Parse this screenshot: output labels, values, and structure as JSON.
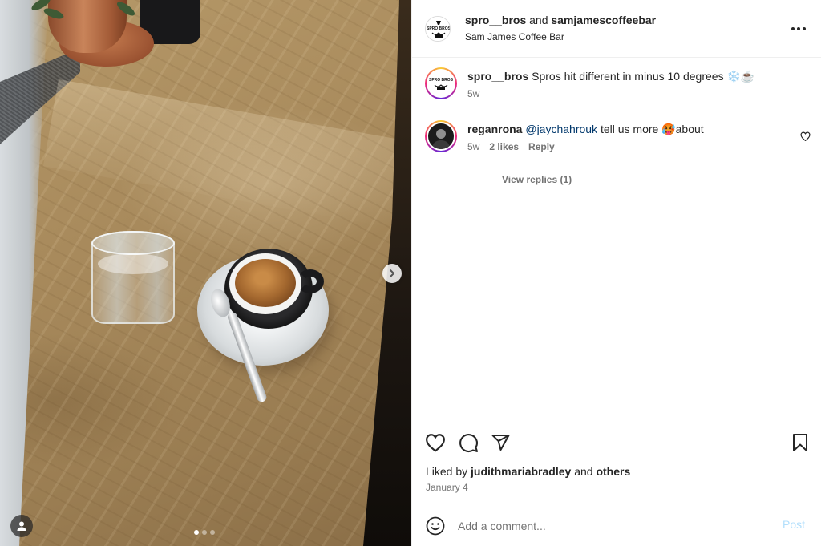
{
  "post": {
    "author": "spro__bros",
    "joiner": "and",
    "collaborator": "samjamescoffeebar",
    "location": "Sam James Coffee Bar",
    "logo_text": "SPRO BROS"
  },
  "media": {
    "carousel_dots": 3,
    "active_dot": 1
  },
  "comments": [
    {
      "user": "spro__bros",
      "text": "Spros hit different in minus 10 degrees ❄️☕",
      "time": "5w"
    },
    {
      "user": "reganrona",
      "mention": "@jaychahrouk",
      "text_before": " tell us more ",
      "emoji": "🥵",
      "text_after": "about",
      "time": "5w",
      "likes": "2 likes",
      "reply_label": "Reply",
      "view_replies": "View replies (1)"
    }
  ],
  "footer": {
    "liked_prefix": "Liked by",
    "liked_user": "judithmariabradley",
    "liked_and": "and",
    "liked_others": "others",
    "date": "January 4",
    "comment_placeholder": "Add a comment...",
    "post_label": "Post"
  },
  "icons": {
    "more": "more-horizontal-icon",
    "like": "heart-icon",
    "comment": "comment-bubble-icon",
    "share": "paper-plane-icon",
    "save": "bookmark-icon",
    "emoji": "smiley-icon",
    "next": "chevron-right-icon",
    "tagged_user": "user-icon"
  },
  "colors": {
    "link": "#00376b",
    "post_button_disabled": "#b2dffc",
    "text_primary": "#262626",
    "text_secondary": "#737373"
  }
}
